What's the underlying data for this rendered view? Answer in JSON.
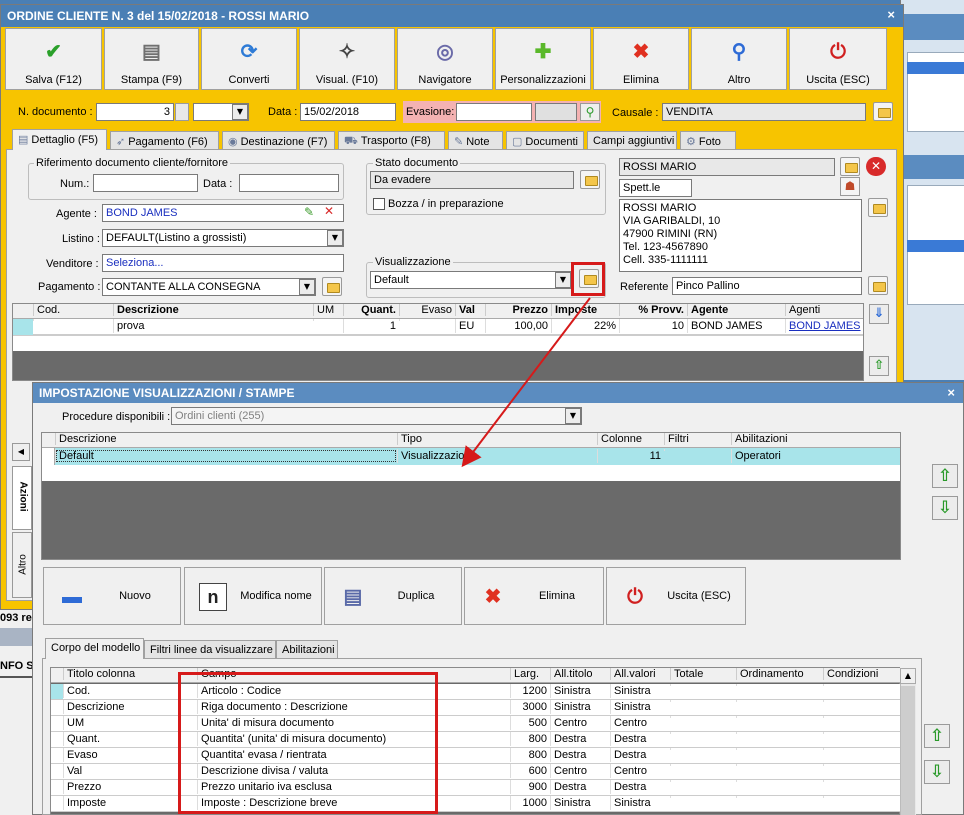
{
  "main": {
    "title": "ORDINE CLIENTE N. 3 del 15/02/2018 - ROSSI MARIO",
    "close": "×",
    "toolbar": [
      {
        "label": "Salva (F12)",
        "icon": "check-icon",
        "glyph": "✔",
        "color": "#2aa02a"
      },
      {
        "label": "Stampa (F9)",
        "icon": "printer-icon",
        "glyph": "▤",
        "color": "#707070"
      },
      {
        "label": "Converti",
        "icon": "convert-icon",
        "glyph": "⟳",
        "color": "#2e7bd6"
      },
      {
        "label": "Visual. (F10)",
        "icon": "magic-wand-icon",
        "glyph": "✧",
        "color": "#444444"
      },
      {
        "label": "Navigatore",
        "icon": "compass-icon",
        "glyph": "◎",
        "color": "#6a6aa8"
      },
      {
        "label": "Personalizzazioni",
        "icon": "puzzle-icon",
        "glyph": "✚",
        "color": "#5ab82a"
      },
      {
        "label": "Elimina",
        "icon": "delete-icon",
        "glyph": "✖",
        "color": "#e03020"
      },
      {
        "label": "Altro",
        "icon": "magnifier-icon",
        "glyph": "⚲",
        "color": "#2e6bd6"
      },
      {
        "label": "Uscita (ESC)",
        "icon": "exit-icon",
        "glyph": "⏻",
        "color": "#d02020"
      }
    ],
    "ndoc_label": "N. documento :",
    "ndoc_value": "3",
    "data_label": "Data :",
    "data_value": "15/02/2018",
    "evasione_label": "Evasione:",
    "causale_label": "Causale :",
    "causale_value": "VENDITA",
    "tabs": [
      "Dettaglio (F5)",
      "Pagamento (F6)",
      "Destinazione (F7)",
      "Trasporto (F8)",
      "Note",
      "Documenti",
      "Campi aggiuntivi",
      "Foto"
    ],
    "rif_group": "Riferimento documento cliente/fornitore",
    "num_label": "Num.:",
    "data2_label": "Data :",
    "stato_group": "Stato documento",
    "stato_value": "Da evadere",
    "bozza_label": "Bozza / in preparazione",
    "agente_label": "Agente :",
    "agente_value": "BOND JAMES",
    "listino_label": "Listino :",
    "listino_value": "DEFAULT(Listino a grossisti)",
    "venditore_label": "Venditore :",
    "venditore_value": "Seleziona...",
    "pagamento_label": "Pagamento :",
    "pagamento_value": "CONTANTE ALLA CONSEGNA",
    "visual_group": "Visualizzazione",
    "visual_value": "Default",
    "cliente_name": "ROSSI MARIO",
    "cliente_title": "Spett.le",
    "address": [
      "ROSSI MARIO",
      "VIA GARIBALDI, 10",
      "47900 RIMINI (RN)",
      "Tel. 123-4567890",
      "Cell. 335-1111111"
    ],
    "referente_label": "Referente",
    "referente_value": "Pinco Pallino",
    "grid_headers": [
      "Cod.",
      "Descrizione",
      "UM",
      "Quant.",
      "Evaso",
      "Val",
      "Prezzo",
      "Imposte",
      "% Provv.",
      "Agente",
      "Agenti"
    ],
    "grid_row": [
      "",
      "prova",
      "",
      "1",
      "",
      "EU",
      "100,00",
      "22%",
      "10",
      "BOND JAMES",
      "BOND JAMES"
    ],
    "side_tabs": [
      "Azioni",
      "Altro"
    ],
    "bg_text": [
      "093 re",
      "NFO SI"
    ]
  },
  "dialog": {
    "title": "IMPOSTAZIONE VISUALIZZAZIONI / STAMPE",
    "close": "×",
    "proc_label": "Procedure disponibili :",
    "proc_value": "Ordini clienti (255)",
    "headers": [
      "Descrizione",
      "Tipo",
      "Colonne",
      "Filtri",
      "Abilitazioni"
    ],
    "row": [
      "Default",
      "Visualizzazione",
      "11",
      "",
      "Operatori"
    ],
    "buttons": [
      "Nuovo",
      "Modifica nome",
      "Duplica",
      "Elimina",
      "Uscita (ESC)"
    ],
    "tabs": [
      "Corpo del modello",
      "Filtri linee da visualizzare",
      "Abilitazioni"
    ],
    "col_headers": [
      "Titolo colonna",
      "Campo",
      "Larg.",
      "All.titolo",
      "All.valori",
      "Totale",
      "Ordinamento",
      "Condizioni"
    ],
    "rows": [
      [
        "Cod.",
        "Articolo : Codice",
        "1200",
        "Sinistra",
        "Sinistra"
      ],
      [
        "Descrizione",
        "Riga documento : Descrizione",
        "3000",
        "Sinistra",
        "Sinistra"
      ],
      [
        "UM",
        "Unita' di misura documento",
        "500",
        "Centro",
        "Centro"
      ],
      [
        "Quant.",
        "Quantita' (unita' di misura documento)",
        "800",
        "Destra",
        "Destra"
      ],
      [
        "Evaso",
        "Quantita' evasa / rientrata",
        "800",
        "Destra",
        "Destra"
      ],
      [
        "Val",
        "Descrizione divisa / valuta",
        "600",
        "Centro",
        "Centro"
      ],
      [
        "Prezzo",
        "Prezzo unitario iva esclusa",
        "900",
        "Destra",
        "Destra"
      ],
      [
        "Imposte",
        "Imposte : Descrizione breve",
        "1000",
        "Sinistra",
        "Sinistra"
      ]
    ]
  },
  "colors": {
    "accent_yellow": "#f7c400",
    "title_blue": "#4a7fb5",
    "highlight_red": "#d61a1a",
    "selected_row": "#a8e4ea"
  }
}
